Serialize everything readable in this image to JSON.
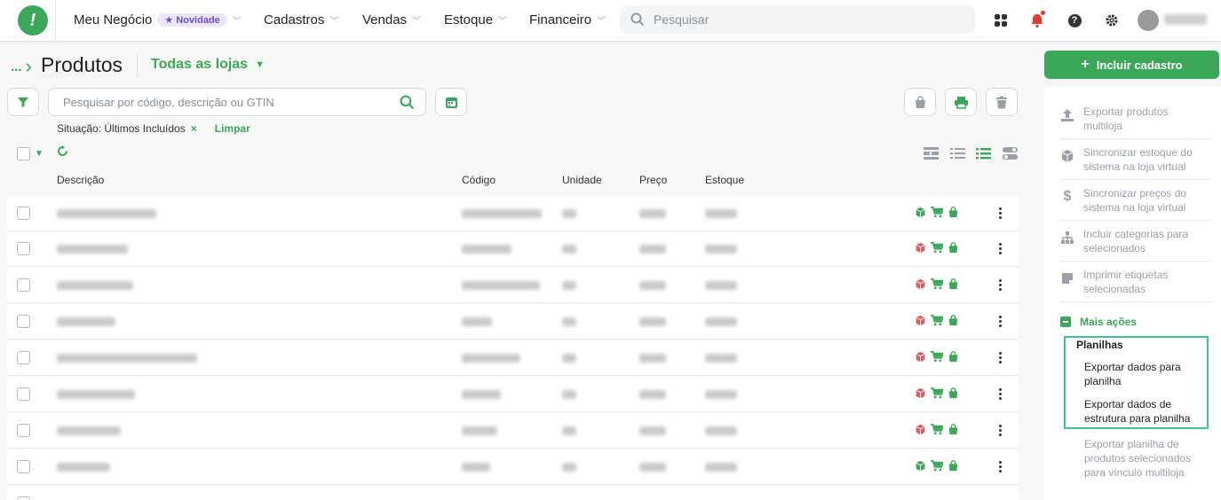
{
  "nav": {
    "logo_glyph": "!",
    "business": "Meu Negócio",
    "badge": "Novidade",
    "items": [
      {
        "label": "Cadastros"
      },
      {
        "label": "Vendas"
      },
      {
        "label": "Estoque"
      },
      {
        "label": "Financeiro"
      }
    ],
    "search_placeholder": "Pesquisar"
  },
  "header": {
    "crumb": "...",
    "title": "Produtos",
    "store_filter": "Todas as lojas"
  },
  "filters": {
    "search_placeholder": "Pesquisar por código, descrição ou GTIN",
    "situation": "Situação: Últimos Incluídos",
    "remove_glyph": "×",
    "clear": "Limpar"
  },
  "table": {
    "columns": [
      "Descrição",
      "Código",
      "Unidade",
      "Preço",
      "Estoque"
    ],
    "rows": [
      {
        "desc": "Kit Presyo Composto",
        "code": "KITCOMPOSTO",
        "unit": "UN",
        "price": "665,00",
        "stock": "1.016,00",
        "box_color": "#3aa858"
      },
      {
        "desc": "Bola Futebol 2",
        "code": "BOLAFUTO",
        "unit": "Un",
        "price": "200,00",
        "stock": "-2,00",
        "box_color": "#e25c5c"
      },
      {
        "desc": "automacao-enviando",
        "code": "autom-enviando",
        "unit": "Un",
        "price": "30,00",
        "stock": "-12,00",
        "box_color": "#e25c5c"
      },
      {
        "desc": "caneca rosa",
        "code": "crosa",
        "unit": "Un",
        "price": "0,00",
        "stock": "-12,00",
        "box_color": "#e25c5c"
      },
      {
        "desc": "EMBALAGEM AUTOMACAO",
        "code": "EMB AUTO",
        "unit": "Un",
        "price": "0,00",
        "stock": "0,00",
        "box_color": "#e25c5c"
      },
      {
        "desc": "Livro Sociologia",
        "code": "LIVROS",
        "unit": "UN",
        "price": "20,00",
        "stock": "-111,00",
        "box_color": "#e25c5c"
      },
      {
        "desc": "Livro Desenho",
        "code": "LIVROD",
        "unit": "UN",
        "price": "30,00",
        "stock": "-381,00",
        "box_color": "#e25c5c"
      },
      {
        "desc": "REMÉDIO",
        "code": "REME",
        "unit": "Un",
        "price": "64,00",
        "stock": "444,00",
        "box_color": "#3aa858"
      }
    ]
  },
  "sidebar": {
    "include_button": "Incluir cadastro",
    "actions": [
      {
        "l1": "Exportar produtos",
        "l2": "multiloja",
        "icon": "upload-icon"
      },
      {
        "l1": "Sincronizar estoque do",
        "l2": "sistema na loja virtual",
        "icon": "box-icon"
      },
      {
        "l1": "Sincronizar preços do",
        "l2": "sistema na loja virtual",
        "icon": "dollar-icon"
      },
      {
        "l1": "Incluir categorias para",
        "l2": "selecionados",
        "icon": "sitemap-icon"
      },
      {
        "l1": "Imprimir etiquetas",
        "l2": "selecionadas",
        "icon": "tag-icon"
      }
    ],
    "more_actions": "Mais ações",
    "sheets_title": "Planilhas",
    "sheet_items": [
      {
        "l1": "Exportar dados para",
        "l2": "planilha"
      },
      {
        "l1": "Exportar dados de",
        "l2": "estrutura para planilha"
      }
    ],
    "sheet_dim": {
      "l1": "Exportar planilha de",
      "l2": "produtos selecionados",
      "l3": "para vínculo multiloja"
    }
  },
  "colors": {
    "accent": "#3aa858",
    "highlight": "#3cc19a",
    "danger": "#e25c5c"
  }
}
